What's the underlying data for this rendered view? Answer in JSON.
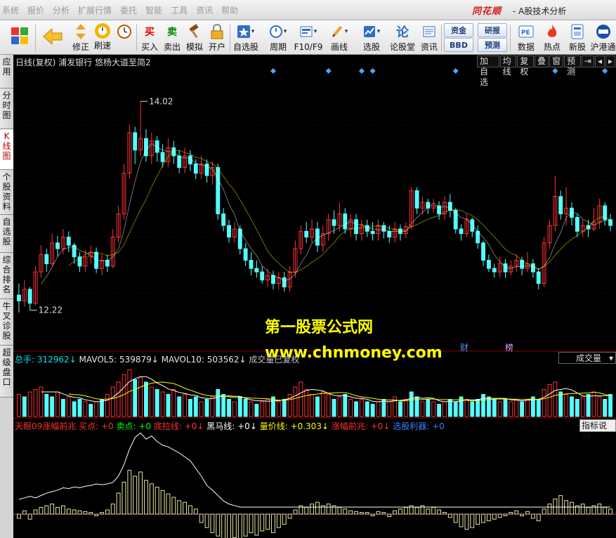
{
  "menu": [
    "系统",
    "报价",
    "分析",
    "扩展行情",
    "委托",
    "智能",
    "工具",
    "资讯",
    "帮助"
  ],
  "logo": "同花顺",
  "app_title": "- A股技术分析",
  "toolbar": {
    "buttons": [
      {
        "label": "修正"
      },
      {
        "label": "刷速"
      },
      {
        "label": "买入"
      },
      {
        "label": "卖出"
      },
      {
        "label": "模拟"
      },
      {
        "label": "开户"
      },
      {
        "label": "自选股"
      },
      {
        "label": "周期"
      },
      {
        "label": "F10/F9"
      },
      {
        "label": "画线"
      },
      {
        "label": "选股"
      },
      {
        "label": "论股堂"
      },
      {
        "label": "资讯"
      },
      {
        "label": "数据"
      },
      {
        "label": "热点"
      },
      {
        "label": "新股"
      },
      {
        "label": "沪港通"
      }
    ],
    "glyphs": {
      "buy": "买",
      "sell": "卖",
      "lun": "论"
    },
    "mini_buttons": [
      "资金",
      "BBD",
      "研报",
      "预测"
    ]
  },
  "side_tabs": [
    "应用",
    "分时图",
    "K线图",
    "个股资料",
    "自选股",
    "综合排名",
    "牛叉诊股",
    "超级盘口"
  ],
  "chart": {
    "header": "日线(复权)  浦发银行  悠杨大道至简2",
    "right_buttons": [
      "加自选",
      "均线",
      "复权",
      "叠",
      "窗",
      "预测",
      "⇥",
      "◂",
      "▸"
    ],
    "high_label": "14.02",
    "low_label": "12.22",
    "events": [
      {
        "text": "财",
        "color": "#5a8cff"
      },
      {
        "text": "榜",
        "color": "#e6a0ff"
      }
    ],
    "watermark_line1": "第一股票公式网",
    "watermark_line2": "www.chnmoney.com"
  },
  "volume": {
    "legend": [
      {
        "text": "总手: 312962↓",
        "color": "#00e5e5"
      },
      {
        "text": " MAVOL5: 539879↓",
        "color": "#e6e6e6"
      },
      {
        "text": " MAVOL10: 503562↓",
        "color": "#e6e6e6"
      },
      {
        "text": "  成交量已复权",
        "color": "#c0c0c0"
      }
    ],
    "dropdown": "成交量"
  },
  "indicator": {
    "legend": [
      {
        "text": "天眼09涨幅前兆",
        "color": "#ff3030"
      },
      {
        "text": "  买点: +0",
        "color": "#ff3030"
      },
      {
        "text": "  卖点: +0",
        "color": "#00ff00"
      },
      {
        "text": "  底拉线: +0↓",
        "color": "#ff3030"
      },
      {
        "text": "  黑马线: +0↓",
        "color": "#ffffff"
      },
      {
        "text": "  量价线: +0.303↓",
        "color": "#ffff00"
      },
      {
        "text": "  涨幅前兆: +0↓",
        "color": "#ff3030"
      },
      {
        "text": "  选股利器: +0",
        "color": "#4080ff"
      }
    ],
    "button": "指标说明"
  },
  "colors": {
    "up": "#ff3232",
    "down": "#54ffff",
    "ma5": "#ffffff",
    "ma10": "#ffff00",
    "diamond": "#4aa8ff"
  },
  "chart_data": {
    "type": "candlestick",
    "ylim": [
      12.0,
      14.3
    ],
    "high": 14.02,
    "low": 12.22,
    "candles": [
      [
        12.35,
        12.3,
        12.45,
        12.2
      ],
      [
        12.3,
        12.4,
        12.48,
        12.25
      ],
      [
        12.4,
        12.28,
        12.42,
        12.22
      ],
      [
        12.28,
        12.55,
        12.6,
        12.26
      ],
      [
        12.55,
        12.7,
        12.78,
        12.5
      ],
      [
        12.7,
        12.62,
        12.75,
        12.55
      ],
      [
        12.62,
        12.8,
        12.88,
        12.6
      ],
      [
        12.8,
        12.75,
        12.86,
        12.68
      ],
      [
        12.75,
        12.85,
        12.92,
        12.7
      ],
      [
        12.85,
        12.78,
        12.9,
        12.72
      ],
      [
        12.78,
        12.68,
        12.8,
        12.62
      ],
      [
        12.68,
        12.6,
        12.72,
        12.55
      ],
      [
        12.6,
        12.68,
        12.74,
        12.55
      ],
      [
        12.68,
        12.72,
        12.78,
        12.62
      ],
      [
        12.72,
        12.58,
        12.76,
        12.54
      ],
      [
        12.58,
        12.65,
        12.7,
        12.52
      ],
      [
        12.65,
        12.6,
        12.7,
        12.55
      ],
      [
        12.6,
        12.85,
        12.92,
        12.58
      ],
      [
        12.85,
        13.05,
        13.12,
        12.8
      ],
      [
        13.05,
        13.4,
        13.48,
        13.0
      ],
      [
        13.4,
        13.75,
        13.82,
        13.35
      ],
      [
        13.75,
        13.6,
        13.8,
        13.48
      ],
      [
        13.6,
        13.7,
        14.02,
        13.55
      ],
      [
        13.7,
        13.55,
        13.78,
        13.5
      ],
      [
        13.55,
        13.68,
        13.75,
        13.48
      ],
      [
        13.68,
        13.58,
        13.72,
        13.5
      ],
      [
        13.58,
        13.5,
        13.65,
        13.45
      ],
      [
        13.5,
        13.62,
        13.7,
        13.45
      ],
      [
        13.62,
        13.55,
        13.68,
        13.48
      ],
      [
        13.55,
        13.45,
        13.6,
        13.4
      ],
      [
        13.45,
        13.55,
        13.62,
        13.4
      ],
      [
        13.55,
        13.48,
        13.6,
        13.42
      ],
      [
        13.48,
        13.4,
        13.52,
        13.35
      ],
      [
        13.4,
        13.48,
        13.55,
        13.35
      ],
      [
        13.48,
        13.38,
        13.52,
        13.32
      ],
      [
        13.38,
        13.45,
        13.5,
        13.3
      ],
      [
        13.45,
        13.05,
        13.48,
        13.0
      ],
      [
        13.05,
        12.95,
        13.1,
        12.9
      ],
      [
        12.95,
        12.85,
        13.0,
        12.8
      ],
      [
        12.85,
        12.92,
        12.98,
        12.8
      ],
      [
        12.92,
        12.75,
        12.95,
        12.7
      ],
      [
        12.75,
        12.65,
        12.8,
        12.6
      ],
      [
        12.65,
        12.58,
        12.72,
        12.52
      ],
      [
        12.58,
        12.55,
        12.65,
        12.5
      ],
      [
        12.55,
        12.48,
        12.6,
        12.45
      ],
      [
        12.48,
        12.52,
        12.58,
        12.42
      ],
      [
        12.52,
        12.45,
        12.56,
        12.4
      ],
      [
        12.45,
        12.5,
        12.55,
        12.4
      ],
      [
        12.5,
        12.42,
        12.55,
        12.38
      ],
      [
        12.42,
        12.55,
        12.6,
        12.38
      ],
      [
        12.55,
        12.75,
        12.82,
        12.5
      ],
      [
        12.75,
        12.9,
        12.95,
        12.7
      ],
      [
        12.9,
        12.85,
        12.98,
        12.8
      ],
      [
        12.85,
        12.92,
        13.0,
        12.8
      ],
      [
        12.92,
        12.78,
        12.98,
        12.72
      ],
      [
        12.78,
        12.88,
        12.95,
        12.72
      ],
      [
        12.88,
        13.0,
        13.05,
        12.82
      ],
      [
        13.0,
        12.95,
        13.08,
        12.88
      ],
      [
        12.95,
        13.05,
        13.15,
        12.9
      ],
      [
        13.05,
        12.92,
        13.1,
        12.88
      ],
      [
        12.92,
        13.0,
        13.05,
        12.85
      ],
      [
        13.0,
        12.88,
        13.05,
        12.82
      ],
      [
        12.88,
        12.95,
        13.0,
        12.82
      ],
      [
        12.95,
        12.9,
        13.0,
        12.85
      ],
      [
        12.9,
        12.88,
        12.98,
        12.82
      ],
      [
        12.88,
        12.95,
        13.0,
        12.82
      ],
      [
        12.95,
        12.9,
        12.98,
        12.84
      ],
      [
        12.9,
        12.85,
        12.95,
        12.8
      ],
      [
        12.85,
        12.92,
        12.98,
        12.8
      ],
      [
        12.92,
        12.88,
        12.96,
        12.82
      ],
      [
        12.88,
        12.94,
        12.98,
        12.84
      ],
      [
        12.94,
        13.25,
        13.28,
        12.92
      ],
      [
        13.25,
        13.1,
        13.28,
        13.05
      ],
      [
        13.1,
        13.15,
        13.2,
        13.05
      ],
      [
        13.15,
        13.1,
        13.18,
        13.05
      ],
      [
        13.1,
        13.12,
        13.18,
        13.06
      ],
      [
        13.12,
        13.05,
        13.16,
        13.0
      ],
      [
        13.05,
        13.15,
        13.2,
        13.0
      ],
      [
        13.15,
        13.08,
        13.22,
        13.02
      ],
      [
        13.08,
        12.92,
        13.1,
        12.88
      ],
      [
        12.92,
        12.88,
        12.96,
        12.82
      ],
      [
        12.88,
        13.0,
        13.05,
        12.85
      ],
      [
        13.0,
        12.9,
        13.02,
        12.85
      ],
      [
        12.9,
        12.8,
        12.95,
        12.75
      ],
      [
        12.8,
        12.65,
        12.82,
        12.6
      ],
      [
        12.65,
        12.58,
        12.7,
        12.55
      ],
      [
        12.58,
        12.55,
        12.62,
        12.5
      ],
      [
        12.55,
        12.62,
        12.68,
        12.5
      ],
      [
        12.62,
        12.55,
        12.66,
        12.5
      ],
      [
        12.55,
        12.6,
        12.65,
        12.52
      ],
      [
        12.6,
        12.65,
        12.7,
        12.55
      ],
      [
        12.65,
        12.58,
        12.68,
        12.52
      ],
      [
        12.58,
        12.62,
        12.72,
        12.55
      ],
      [
        12.62,
        12.55,
        12.66,
        12.5
      ],
      [
        12.55,
        12.45,
        12.58,
        12.4
      ],
      [
        12.45,
        12.8,
        12.85,
        12.42
      ],
      [
        12.8,
        12.95,
        13.0,
        12.75
      ],
      [
        12.95,
        13.2,
        13.38,
        12.9
      ],
      [
        13.2,
        13.05,
        13.25,
        13.0
      ],
      [
        13.05,
        13.1,
        13.28,
        12.95
      ],
      [
        13.1,
        13.02,
        13.15,
        12.95
      ],
      [
        13.02,
        12.9,
        13.05,
        12.85
      ],
      [
        12.9,
        12.95,
        13.0,
        12.85
      ],
      [
        12.95,
        12.92,
        13.0,
        12.85
      ],
      [
        12.92,
        12.98,
        13.1,
        12.9
      ],
      [
        12.98,
        13.12,
        13.18,
        12.92
      ],
      [
        13.12,
        13.0,
        13.15,
        12.95
      ],
      [
        13.0,
        12.95,
        13.05,
        12.9
      ]
    ],
    "volume": [
      [
        0.45,
        1
      ],
      [
        0.4,
        0
      ],
      [
        0.5,
        1
      ],
      [
        0.55,
        1
      ],
      [
        0.6,
        1
      ],
      [
        0.45,
        0
      ],
      [
        0.4,
        0
      ],
      [
        0.5,
        1
      ],
      [
        0.35,
        0
      ],
      [
        0.4,
        1
      ],
      [
        0.3,
        0
      ],
      [
        0.35,
        0
      ],
      [
        0.3,
        1
      ],
      [
        0.25,
        0
      ],
      [
        0.3,
        1
      ],
      [
        0.35,
        0
      ],
      [
        0.45,
        1
      ],
      [
        0.6,
        1
      ],
      [
        0.7,
        1
      ],
      [
        0.85,
        1
      ],
      [
        0.95,
        1
      ],
      [
        0.75,
        0
      ],
      [
        0.8,
        1
      ],
      [
        0.7,
        0
      ],
      [
        0.6,
        1
      ],
      [
        0.55,
        0
      ],
      [
        0.5,
        1
      ],
      [
        0.45,
        0
      ],
      [
        0.55,
        1
      ],
      [
        0.4,
        0
      ],
      [
        0.45,
        1
      ],
      [
        0.35,
        0
      ],
      [
        0.4,
        0
      ],
      [
        0.3,
        1
      ],
      [
        0.35,
        0
      ],
      [
        0.4,
        1
      ],
      [
        0.55,
        0
      ],
      [
        0.45,
        0
      ],
      [
        0.35,
        0
      ],
      [
        0.3,
        1
      ],
      [
        0.4,
        0
      ],
      [
        0.35,
        0
      ],
      [
        0.3,
        1
      ],
      [
        0.25,
        0
      ],
      [
        0.3,
        1
      ],
      [
        0.35,
        1
      ],
      [
        0.4,
        0
      ],
      [
        0.3,
        1
      ],
      [
        0.35,
        0
      ],
      [
        0.45,
        1
      ],
      [
        0.6,
        1
      ],
      [
        0.7,
        1
      ],
      [
        0.55,
        1
      ],
      [
        0.45,
        1
      ],
      [
        0.4,
        0
      ],
      [
        0.5,
        1
      ],
      [
        0.45,
        1
      ],
      [
        0.35,
        0
      ],
      [
        0.4,
        1
      ],
      [
        0.45,
        0
      ],
      [
        0.35,
        1
      ],
      [
        0.3,
        0
      ],
      [
        0.35,
        1
      ],
      [
        0.3,
        0
      ],
      [
        0.25,
        0
      ],
      [
        0.3,
        1
      ],
      [
        0.35,
        0
      ],
      [
        0.3,
        1
      ],
      [
        0.4,
        1
      ],
      [
        0.3,
        0
      ],
      [
        0.35,
        1
      ],
      [
        0.5,
        0
      ],
      [
        0.4,
        0
      ],
      [
        0.3,
        1
      ],
      [
        0.35,
        0
      ],
      [
        0.3,
        1
      ],
      [
        0.25,
        0
      ],
      [
        0.3,
        1
      ],
      [
        0.35,
        0
      ],
      [
        0.3,
        0
      ],
      [
        0.4,
        0
      ],
      [
        0.35,
        1
      ],
      [
        0.3,
        0
      ],
      [
        0.35,
        0
      ],
      [
        0.45,
        0
      ],
      [
        0.4,
        0
      ],
      [
        0.35,
        0
      ],
      [
        0.3,
        1
      ],
      [
        0.35,
        0
      ],
      [
        0.3,
        1
      ],
      [
        0.35,
        1
      ],
      [
        0.3,
        0
      ],
      [
        0.35,
        1
      ],
      [
        0.4,
        0
      ],
      [
        0.35,
        0
      ],
      [
        0.55,
        1
      ],
      [
        0.65,
        1
      ],
      [
        0.7,
        1
      ],
      [
        0.5,
        0
      ],
      [
        0.45,
        1
      ],
      [
        0.4,
        0
      ],
      [
        0.35,
        0
      ],
      [
        0.4,
        1
      ],
      [
        0.45,
        0
      ],
      [
        0.5,
        1
      ],
      [
        0.4,
        1
      ],
      [
        0.35,
        0
      ],
      [
        0.45,
        0
      ]
    ],
    "indicator_line": [
      0.1,
      0.12,
      0.14,
      0.12,
      0.15,
      0.18,
      0.2,
      0.22,
      0.25,
      0.24,
      0.26,
      0.25,
      0.27,
      0.28,
      0.3,
      0.29,
      0.3,
      0.32,
      0.4,
      0.55,
      0.75,
      0.9,
      0.96,
      0.88,
      0.92,
      0.85,
      0.8,
      0.78,
      0.74,
      0.7,
      0.65,
      0.6,
      0.5,
      0.4,
      0.28,
      0.22,
      0.15,
      0.08,
      0.04,
      0.02,
      0.0,
      0.0,
      0.0,
      0.0,
      0.0,
      0.0,
      0.0,
      0.0,
      0.0,
      0.0,
      0.0,
      0.0,
      0.0,
      0.0,
      0.0,
      0.0,
      0.0,
      0.0,
      0.0,
      0.0,
      0.0,
      0.0,
      0.0,
      0.0,
      0.0,
      0.0,
      0.0,
      0.0,
      0.0,
      0.0,
      0.0,
      0.0,
      0.0,
      0.0,
      0.0,
      0.0,
      0.0,
      0.0,
      0.0,
      0.0,
      0.0,
      0.0,
      0.0,
      0.0,
      0.0,
      0.0,
      0.0,
      0.0,
      0.0,
      0.0,
      0.0,
      0.0,
      0.0,
      0.0,
      0.0,
      0.0,
      0.0,
      0.0,
      0.0,
      0.0,
      0.0,
      0.0,
      0.0,
      0.0,
      0.0,
      0.0,
      0.0,
      0.0
    ],
    "indicator_bars": [
      -0.05,
      0.04,
      -0.06,
      0.05,
      0.08,
      0.1,
      0.12,
      0.08,
      0.1,
      0.06,
      0.05,
      0.04,
      0.03,
      0.02,
      -0.02,
      0.02,
      0.05,
      0.12,
      0.25,
      0.38,
      0.52,
      0.45,
      0.5,
      0.4,
      0.36,
      0.32,
      0.28,
      0.24,
      0.2,
      0.16,
      0.14,
      0.1,
      0.06,
      -0.1,
      -0.16,
      -0.22,
      -0.26,
      -0.3,
      -0.32,
      -0.28,
      -0.3,
      -0.26,
      -0.22,
      -0.25,
      -0.2,
      -0.18,
      -0.22,
      -0.16,
      -0.12,
      -0.05,
      0.05,
      0.1,
      0.08,
      0.12,
      0.14,
      0.1,
      0.12,
      0.1,
      0.08,
      0.06,
      0.04,
      0.03,
      0.02,
      0.02,
      -0.02,
      0.03,
      0.02,
      -0.03,
      0.04,
      0.06,
      0.08,
      0.1,
      0.08,
      0.1,
      0.06,
      0.08,
      0.05,
      0.02,
      -0.04,
      -0.1,
      -0.15,
      -0.18,
      -0.16,
      -0.12,
      -0.1,
      -0.08,
      -0.06,
      -0.04,
      -0.02,
      0.02,
      0.04,
      -0.02,
      0.03,
      -0.05,
      -0.08,
      0.06,
      0.12,
      0.18,
      0.22,
      0.16,
      0.14,
      0.1,
      0.12,
      0.08,
      0.1,
      0.12,
      0.08,
      0.06
    ],
    "diamonds_idx": [
      46,
      56,
      62,
      64,
      79,
      97,
      106
    ]
  }
}
